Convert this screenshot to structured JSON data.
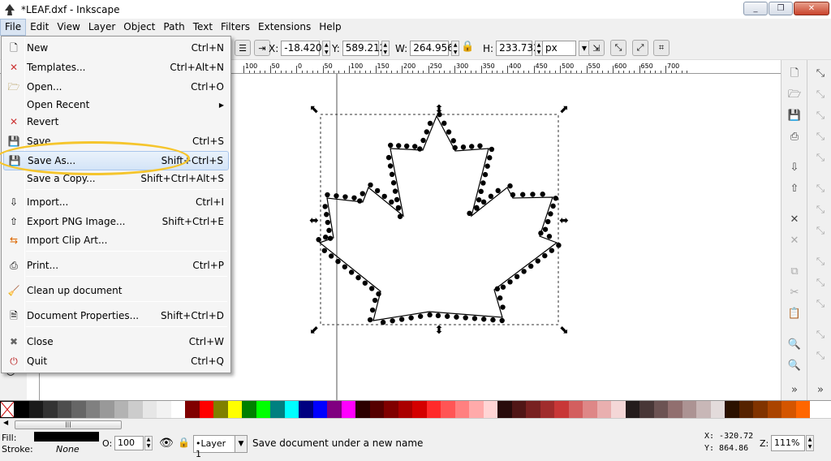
{
  "window": {
    "title": "*LEAF.dxf - Inkscape",
    "minimize": "_",
    "maximize": "❐",
    "close": "✕"
  },
  "menubar": [
    "File",
    "Edit",
    "View",
    "Layer",
    "Object",
    "Path",
    "Text",
    "Filters",
    "Extensions",
    "Help"
  ],
  "toolbar": {
    "x_label": "X:",
    "x_value": "-18.420",
    "y_label": "Y:",
    "y_value": "589.212",
    "w_label": "W:",
    "w_value": "264.956",
    "h_label": "H:",
    "h_value": "233.732",
    "unit": "px"
  },
  "ruler_labels": [
    "100",
    "50",
    "0",
    "50",
    "100",
    "150",
    "200",
    "250",
    "300",
    "350",
    "400",
    "450",
    "500",
    "550",
    "600",
    "650",
    "700"
  ],
  "file_menu": [
    {
      "label": "New",
      "shortcut": "Ctrl+N",
      "icon": "new-document-icon"
    },
    {
      "label": "Templates...",
      "shortcut": "Ctrl+Alt+N",
      "icon": "templates-icon"
    },
    {
      "label": "Open...",
      "shortcut": "Ctrl+O",
      "icon": "open-folder-icon"
    },
    {
      "label": "Open Recent",
      "shortcut": "",
      "icon": "",
      "submenu": "▶"
    },
    {
      "label": "Revert",
      "shortcut": "",
      "icon": "revert-icon"
    },
    {
      "label": "Save",
      "shortcut": "Ctrl+S",
      "icon": "save-icon"
    },
    {
      "label": "Save As...",
      "shortcut": "Shift+Ctrl+S",
      "icon": "save-as-icon"
    },
    {
      "label": "Save a Copy...",
      "shortcut": "Shift+Ctrl+Alt+S",
      "icon": ""
    },
    {
      "label": "Import...",
      "shortcut": "Ctrl+I",
      "icon": "import-icon"
    },
    {
      "label": "Export PNG Image...",
      "shortcut": "Shift+Ctrl+E",
      "icon": "export-png-icon"
    },
    {
      "label": "Import Clip Art...",
      "shortcut": "",
      "icon": "import-clipart-icon"
    },
    {
      "label": "Print...",
      "shortcut": "Ctrl+P",
      "icon": "print-icon"
    },
    {
      "label": "Clean up document",
      "shortcut": "",
      "icon": "clean-up-icon"
    },
    {
      "label": "Document Properties...",
      "shortcut": "Shift+Ctrl+D",
      "icon": "document-properties-icon"
    },
    {
      "label": "Close",
      "shortcut": "Ctrl+W",
      "icon": "close-icon"
    },
    {
      "label": "Quit",
      "shortcut": "Ctrl+Q",
      "icon": "quit-icon"
    }
  ],
  "status": {
    "fill_label": "Fill:",
    "stroke_label": "Stroke:",
    "stroke_value": "None",
    "opacity_label": "O:",
    "opacity_value": "100",
    "layer": "•Layer 1",
    "message": "Save document under a new name",
    "x_coord": "X: -320.72",
    "y_coord": "Y:  864.86",
    "zoom_label": "Z:",
    "zoom_value": "111%"
  },
  "palette": [
    "#000000",
    "#1a1a1a",
    "#333333",
    "#4d4d4d",
    "#666666",
    "#808080",
    "#999999",
    "#b3b3b3",
    "#cccccc",
    "#e6e6e6",
    "#f2f2f2",
    "#ffffff",
    "#800000",
    "#ff0000",
    "#808000",
    "#ffff00",
    "#008000",
    "#00ff00",
    "#008080",
    "#00ffff",
    "#000080",
    "#0000ff",
    "#800080",
    "#ff00ff",
    "#2b0000",
    "#550000",
    "#800000",
    "#aa0000",
    "#d40000",
    "#ff2a2a",
    "#ff5555",
    "#ff8080",
    "#ffaaaa",
    "#ffd5d5",
    "#280b0b",
    "#501616",
    "#782121",
    "#a02c2c",
    "#c83737",
    "#d35f5f",
    "#de8787",
    "#e9afaf",
    "#f4d7d7",
    "#241c1c",
    "#483737",
    "#6c5353",
    "#916f6f",
    "#ac9393",
    "#c8b7b7",
    "#e3dbdb",
    "#2b1100",
    "#552200",
    "#803300",
    "#aa4400",
    "#d45500",
    "#ff6600"
  ],
  "colors": {
    "highlight_ellipse": "#f5c52c",
    "menu_highlight": "#d4e4f7"
  }
}
